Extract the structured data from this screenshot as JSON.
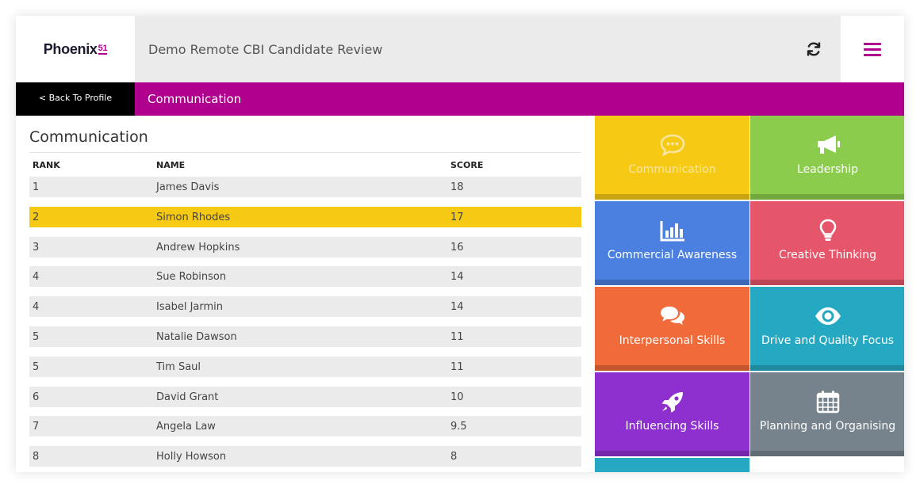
{
  "app": {
    "logo_text": "Phoenix",
    "logo_sub": "51",
    "title": "Demo Remote CBI Candidate Review"
  },
  "nav": {
    "back_label": "< Back To Profile",
    "section_label": "Communication"
  },
  "table": {
    "title": "Communication",
    "headers": {
      "rank": "RANK",
      "name": "NAME",
      "score": "SCORE"
    },
    "rows": [
      {
        "rank": "1",
        "name": "James Davis",
        "score": "18"
      },
      {
        "rank": "2",
        "name": "Simon Rhodes",
        "score": "17"
      },
      {
        "rank": "3",
        "name": "Andrew Hopkins",
        "score": "16"
      },
      {
        "rank": "4",
        "name": "Sue Robinson",
        "score": "14"
      },
      {
        "rank": "4",
        "name": "Isabel Jarmin",
        "score": "14"
      },
      {
        "rank": "5",
        "name": "Natalie Dawson",
        "score": "11"
      },
      {
        "rank": "5",
        "name": "Tim Saul",
        "score": "11"
      },
      {
        "rank": "6",
        "name": "David Grant",
        "score": "10"
      },
      {
        "rank": "7",
        "name": "Angela Law",
        "score": "9.5"
      },
      {
        "rank": "8",
        "name": "Holly Howson",
        "score": "8"
      }
    ],
    "highlight_color": "#f6c915"
  },
  "tiles": [
    {
      "label": "Communication",
      "icon": "speech-bubble-icon",
      "color": "#f6c915"
    },
    {
      "label": "Leadership",
      "icon": "megaphone-icon",
      "color": "#8ccc4c"
    },
    {
      "label": "Commercial Awareness",
      "icon": "bar-chart-icon",
      "color": "#4b7fe0"
    },
    {
      "label": "Creative Thinking",
      "icon": "lightbulb-icon",
      "color": "#e6566a"
    },
    {
      "label": "Interpersonal Skills",
      "icon": "chat-bubbles-icon",
      "color": "#f06a3a"
    },
    {
      "label": "Drive and Quality Focus",
      "icon": "eye-icon",
      "color": "#25a8c2"
    },
    {
      "label": "Influencing Skills",
      "icon": "rocket-icon",
      "color": "#8e30cf"
    },
    {
      "label": "Planning and Organising",
      "icon": "calendar-icon",
      "color": "#76838c"
    }
  ],
  "colors": {
    "brand": "#b0008e",
    "header_bg": "#ebebeb",
    "back_bg": "#000000"
  }
}
